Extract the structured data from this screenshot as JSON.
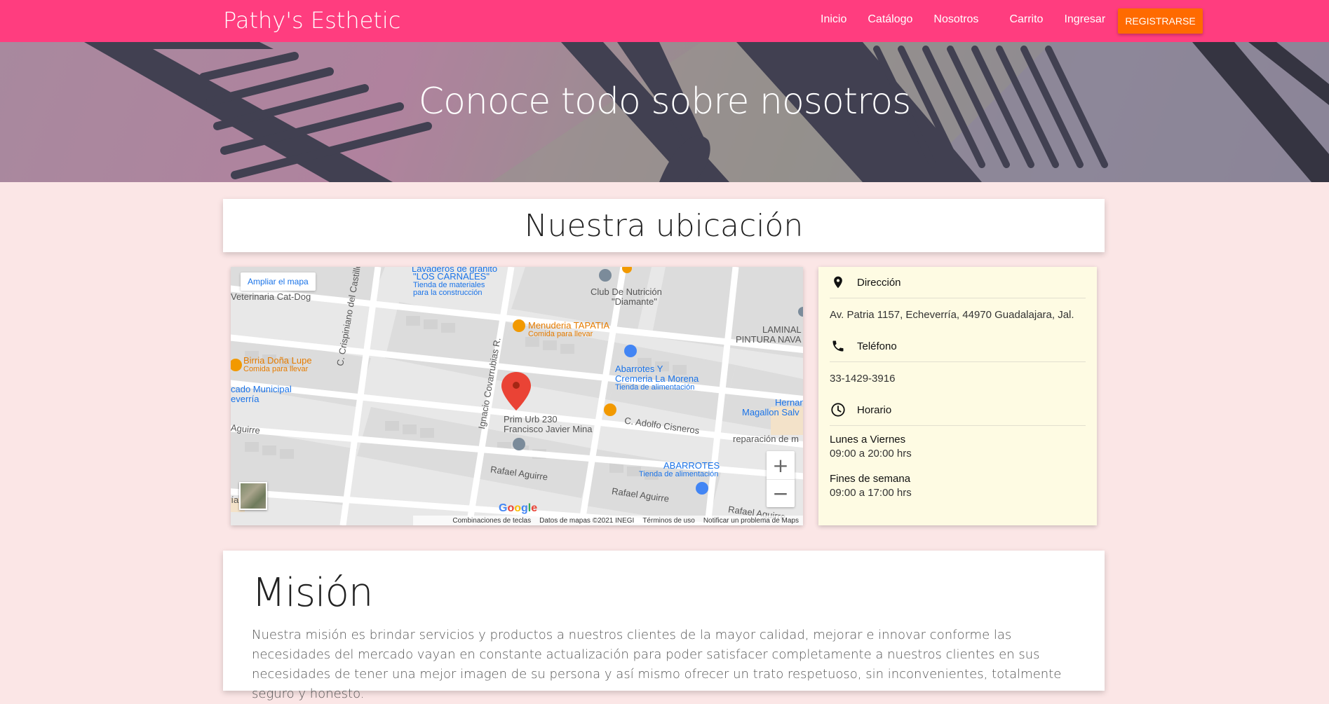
{
  "navbar": {
    "brand": "Pathy's Esthetic",
    "links": [
      "Inicio",
      "Catálogo",
      "Nosotros",
      "Carrito",
      "Ingresar"
    ],
    "register_label": "REGISTRARSE",
    "color": "#ff3d7f",
    "register_color": "#ff6a00"
  },
  "hero": {
    "title": "Conoce todo sobre nosotros"
  },
  "location": {
    "title": "Nuestra ubicación"
  },
  "map": {
    "enlarge_label": "Ampliar el mapa",
    "labels": {
      "veterinaria": "Veterinaria Cat-Dog",
      "lavaderos_1": "Lavaderos de granito",
      "lavaderos_2": "\"LOS CARNALES\"",
      "lavaderos_sub_1": "Tienda de materiales",
      "lavaderos_sub_2": "para la construcción",
      "club_1": "Club De Nutrición",
      "club_2": "\"Diamante\"",
      "menuderia": "Menuderia TAPATIA",
      "menuderia_sub": "Comida para llevar",
      "lamina_1": "LAMINAL",
      "lamina_2": "PINTURA NAVA",
      "birria": "Birria Doña Lupe",
      "birria_sub": "Comida para llevar",
      "mercado_1": "cado Municipal",
      "mercado_2": "everría",
      "abarrotes_1": "Abarrotes Y",
      "abarrotes_2": "Cremeria La Morena",
      "abarrotes_sub": "Tienda de alimentación",
      "hernan_1": "Hernan",
      "hernan_2": "Magallon Salv",
      "prim_1": "Prim Urb 230",
      "prim_2": "Francisco Javier Mina",
      "reparacion": "reparación de m",
      "abarrotes2": "ABARROTES",
      "abarrotes2_sub": "Tienda de alimentación",
      "road_aguirre_left": "Aguirre",
      "road_crispiniano": "C. Crispiniano del Castillo",
      "road_ignacio": "Ignacio Covarrubias R.",
      "road_adolfo": "C. Adolfo Cisneros",
      "road_rafael_1": "Rafael Aguirre",
      "road_rafael_2": "Rafael Aguirre",
      "road_rafael_3": "Rafael Aguirre",
      "ria": "ría"
    },
    "google_logo": "Google",
    "footer": [
      "Combinaciones de teclas",
      "Datos de mapas ©2021 INEGI",
      "Términos de uso",
      "Notificar un problema de Maps"
    ],
    "zoom_in": "+",
    "zoom_out": "−"
  },
  "info": {
    "address_label": "Dirección",
    "address": "Av. Patria 1157, Echeverría, 44970 Guadalajara, Jal.",
    "phone_label": "Teléfono",
    "phone": "33-1429-3916",
    "hours_label": "Horario",
    "weekdays_title": "Lunes a Viernes",
    "weekdays_hours": "09:00 a 20:00 hrs",
    "weekend_title": "Fines de semana",
    "weekend_hours": "09:00 a 17:00 hrs",
    "background": "#fefbe3"
  },
  "mission": {
    "title": "Misión",
    "text": "Nuestra misión es brindar servicios y productos a nuestros clientes de la mayor calidad, mejorar e innovar conforme las necesidades del mercado vayan en constante actualización para poder satisfacer completamente a nuestros clientes en sus necesidades de tener una mejor imagen de su persona y así mismo ofrecer un trato respetuoso, sin inconvenientes, totalmente seguro y honesto."
  }
}
